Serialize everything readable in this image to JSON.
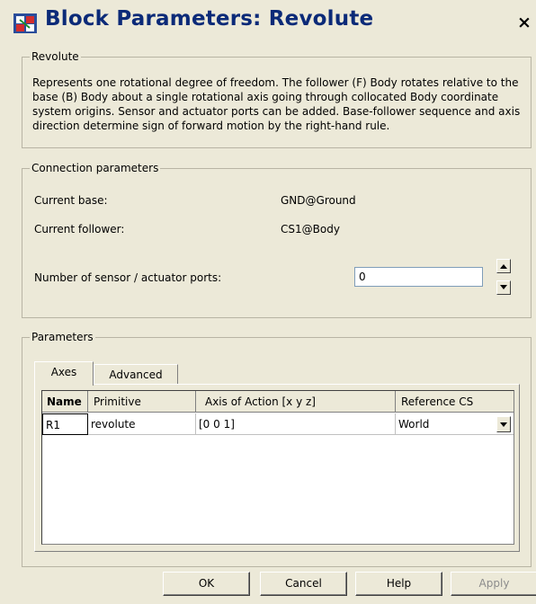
{
  "window": {
    "title": "Block Parameters: Revolute",
    "close_label": "×"
  },
  "revolute_group": {
    "legend": "Revolute",
    "description": "Represents one rotational degree of freedom. The follower (F) Body rotates relative to the base (B) Body about a single rotational axis going through collocated Body coordinate system origins. Sensor and actuator ports can be added. Base-follower sequence and axis direction determine sign of forward motion by the right-hand rule."
  },
  "connection": {
    "legend": "Connection parameters",
    "current_base_label": "Current base:",
    "current_base_value": "GND@Ground",
    "current_follower_label": "Current follower:",
    "current_follower_value": "CS1@Body",
    "ports_label": "Number of sensor / actuator ports:",
    "ports_value": "0"
  },
  "parameters": {
    "legend": "Parameters",
    "tabs": [
      {
        "label": "Axes",
        "selected": true
      },
      {
        "label": "Advanced",
        "selected": false
      }
    ],
    "table": {
      "headers": [
        "Name",
        "Primitive",
        "Axis of Action [x y z]",
        "Reference CS"
      ],
      "rows": [
        {
          "name": "R1",
          "primitive": "revolute",
          "axis": "[0 0 1]",
          "reference": "World"
        }
      ]
    }
  },
  "buttons": {
    "ok": "OK",
    "cancel": "Cancel",
    "help": "Help",
    "apply": "Apply"
  },
  "colors": {
    "dialog_bg": "#ece9d8",
    "title_text": "#0b2a78"
  }
}
